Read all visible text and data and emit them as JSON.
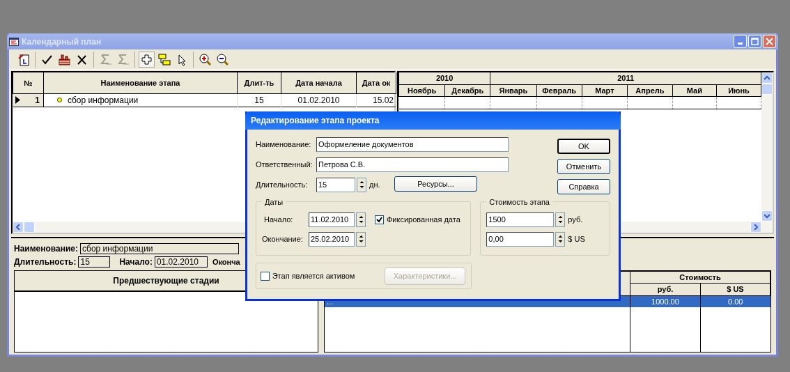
{
  "window": {
    "title": "Календарный план"
  },
  "toolbar": {
    "groups": [
      [
        {
          "pressed": false,
          "disabled": false
        }
      ],
      [
        {
          "pressed": false,
          "disabled": false
        },
        {
          "pressed": false,
          "disabled": false
        },
        {
          "pressed": false,
          "disabled": false
        }
      ],
      [
        {
          "pressed": false,
          "disabled": true
        },
        {
          "pressed": false,
          "disabled": true
        }
      ],
      [
        {
          "pressed": true,
          "disabled": false
        },
        {
          "pressed": false,
          "disabled": false
        },
        {
          "pressed": false,
          "disabled": false
        }
      ],
      [
        {
          "pressed": false,
          "disabled": false
        },
        {
          "pressed": false,
          "disabled": false
        }
      ]
    ]
  },
  "stages_table": {
    "columns": [
      "№",
      "Наименование этапа",
      "Длит-ть",
      "Дата начала",
      "Дата ок"
    ],
    "rows": [
      {
        "current": true,
        "cells": [
          "1",
          "сбор информации",
          "15",
          "01.02.2010",
          "15.02"
        ]
      }
    ]
  },
  "gantt": {
    "years": [
      {
        "label": "2010",
        "months": [
          "Ноябрь",
          "Декабрь"
        ]
      },
      {
        "label": "2011",
        "months": [
          "Январь",
          "Февраль",
          "Март",
          "Апрель",
          "Май",
          "Июнь"
        ]
      }
    ]
  },
  "details": {
    "name": {
      "label": "Наименование:",
      "value": "сбор информации"
    },
    "duration": {
      "label": "Длительность:",
      "value": "15"
    },
    "start": {
      "label": "Начало:",
      "value": "01.02.2010"
    },
    "end": {
      "label": "Оконча"
    }
  },
  "predecessors": {
    "header": "Предшествующие стадии"
  },
  "resources": {
    "cost_header": "Стоимость",
    "columns": [
      "",
      "руб.",
      "$ US"
    ],
    "rows": [
      {
        "selected": true,
        "cells": [
          "...",
          "1000.00",
          "0.00"
        ]
      }
    ]
  },
  "dialog": {
    "title": "Редактирование этапа проекта",
    "name": {
      "label": "Наименование:",
      "value": "Оформеление документов"
    },
    "responsible": {
      "label": "Ответственный:",
      "value": "Петрова С.В."
    },
    "duration": {
      "label": "Длительность:",
      "value": "15",
      "unit": "дн."
    },
    "resources_button": "Ресурсы...",
    "dates": {
      "legend": "Даты",
      "start": {
        "label": "Начало:",
        "value": "11.02.2010"
      },
      "end": {
        "label": "Окончание:",
        "value": "25.02.2010"
      },
      "fixed": {
        "label": "Фиксированная дата",
        "checked": true
      }
    },
    "cost": {
      "legend": "Стоимость этапа",
      "rub": {
        "value": "1500",
        "unit": "руб."
      },
      "usd": {
        "value": "0,00",
        "unit": "$ US"
      }
    },
    "asset": {
      "label": "Этап является активом",
      "checked": false
    },
    "characteristics_button": {
      "label": "Характеристики...",
      "disabled": true
    },
    "buttons": [
      {
        "label": "OK",
        "default": true
      },
      {
        "label": "Отменить",
        "default": false
      },
      {
        "label": "Справка",
        "default": false
      }
    ]
  }
}
